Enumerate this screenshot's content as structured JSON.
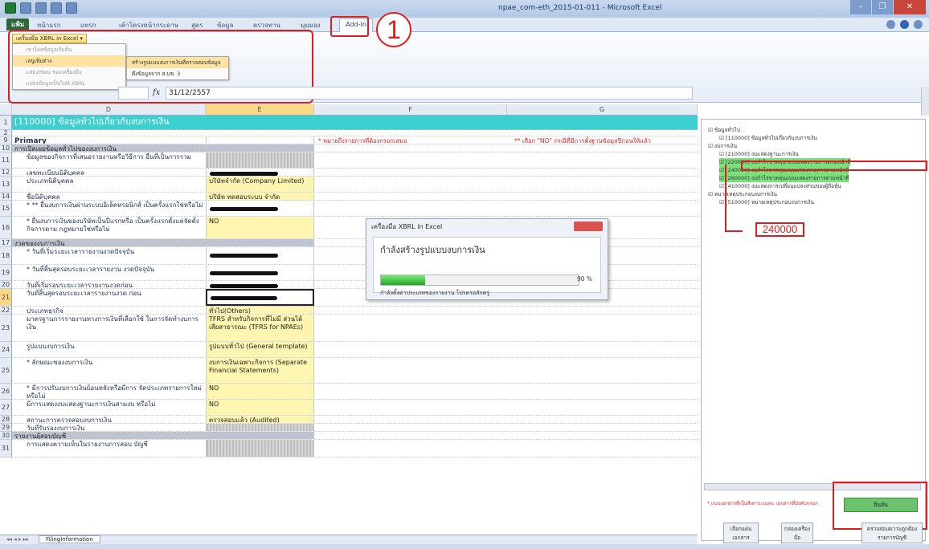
{
  "window": {
    "title": "npae_com-eth_2015-01-011 - Microsoft Excel"
  },
  "ribbon": {
    "file_tab": "แฟ้ม",
    "tabs": [
      "หน้าแรก",
      "แทรก",
      "เค้าโครงหน้ากระดาษ",
      "สูตร",
      "ข้อมูล",
      "ตรวจทาน",
      "มุมมอง"
    ],
    "addin_tab": "Add-In",
    "xbrl_button": "เครื่องมือ XBRL in Excel ▾",
    "menu_items": [
      "เขาโลหข้อมูลเริ่มต้น",
      "เลนูเพิ่มต่าง",
      "เเสดง/ซ่อน ชองเครื่องมือ",
      "เเปลงข้อมูลเป็นไฟล์ XBRL"
    ],
    "submenu_items": [
      "สร้างรูปแบบงบการเงินที่ตรวจสอบข้อมูล",
      "ดึงข้อมูลจาก ส.บช. 3"
    ]
  },
  "annotation": {
    "circle_label": "1",
    "label_240": "240000"
  },
  "formula_bar": {
    "fx_label": "fx",
    "value": "31/12/2557"
  },
  "grid": {
    "columns": [
      "D",
      "E",
      "F",
      "G"
    ],
    "note_required": "* หมายถึงรายการที่ต้องกรอกเสมอ",
    "note_no": "** เลือก \"NO\" กรณีที่มีการตั้งฐานข้อมูลปีกอนให้แล้ว",
    "rows": [
      {
        "num": "1",
        "d": "[110000] ข้อมูลทั่วไปเกี่ยวกับงบการเงิน",
        "e": ""
      },
      {
        "num": "2",
        "d": "",
        "e": ""
      },
      {
        "num": "9",
        "d": "Primary",
        "e": ""
      },
      {
        "num": "10",
        "d": "การเปิดเผยข้อมูลทั่วไปของงบการเงิน",
        "e": ""
      },
      {
        "num": "11",
        "d": "ข้อมูลของกิจการที่เสนอรายงานหรือวิธีการ อื่นที่เป็นการรวม",
        "e": ""
      },
      {
        "num": "12",
        "d": "เลขทะเบียนนิติบุคคล",
        "e": ""
      },
      {
        "num": "13",
        "d": "ประเภทนิติบุคคล",
        "e": "บริษัทจำกัด (Company Limited)"
      },
      {
        "num": "14",
        "d": "ชื่อนิติบุคคล",
        "e": "บริษัท ทดสอบระบบ จำกัด"
      },
      {
        "num": "15",
        "d": "* ** ยื่นงบการเงินผ่านระบบอิเล็คทรอนิกส์ เป็นครั้งแรกใช่หรือไม่",
        "e": ""
      },
      {
        "num": "16",
        "d": "* ยื่นงบการเงินของบริษัทเป็นปีแรกหรือ เป็นครั้งแรกตั้งแต่จัดตั้งกิจการตาม กฎหมายใช่หรือไม่",
        "e": "NO"
      },
      {
        "num": "17",
        "d": "งวดของงบการเงิน",
        "e": ""
      },
      {
        "num": "18",
        "d": "* วันที่เริ่มระยะเวลารายงานงวดปัจจุบัน",
        "e": ""
      },
      {
        "num": "19",
        "d": "* วันที่สิ้นสุดรอบระยะเวลารายงาน งวดปัจจุบัน",
        "e": ""
      },
      {
        "num": "20",
        "d": "วันที่เริ่มรอบระยะเวลารายงานงวดก่อน",
        "e": ""
      },
      {
        "num": "21",
        "d": "วันที่สิ้นสุดรอบระยะเวลารายงานงวด ก่อน",
        "e": ""
      },
      {
        "num": "22",
        "d": "ประเภทธุรกิจ",
        "e": "ทั่วไป(Others)"
      },
      {
        "num": "23",
        "d": "มาตรฐานการรายงานทางการเงินที่เลือกใช้ ในการจัดทำงบการเงิน",
        "e": "TFRS สำหรับกิจการที่ไม่มี ส่วนได้เสียสาธารณะ (TFRS for NPAEs)"
      },
      {
        "num": "24",
        "d": "รูปแบบงบการเงิน",
        "e": "รูปแบบทั่วไป (General template)"
      },
      {
        "num": "25",
        "d": "* ลักษณะของงบการเงิน",
        "e": "งบการเงินเฉพาะกิจการ (Separate Financial Statements)"
      },
      {
        "num": "26",
        "d": "* มีการปรับงบการเงินย้อนหลังหรือมีการ จัดประเภทรายการใหม่หรือไม่",
        "e": "NO"
      },
      {
        "num": "27",
        "d": "มีการแสดงงบแสดงฐานะการเงินสามงบ หรือไม่",
        "e": "NO"
      },
      {
        "num": "28",
        "d": "สถานะการตรวจสอบงบการเงิน",
        "e": "ตรวจสอบแล้ว (Audited)"
      },
      {
        "num": "29",
        "d": "วันที่รับรองงบการเงิน",
        "e": ""
      },
      {
        "num": "30",
        "d": "รายงานผู้สอบบัญชี",
        "e": ""
      },
      {
        "num": "31",
        "d": "การแสดงความเห็นในรายงานการสอบ บัญชี",
        "e": ""
      }
    ]
  },
  "dialog": {
    "title": "เครื่องมือ XBRL in Excel",
    "heading": "กำลังสร้างรูปแบบงบการเงิน",
    "progress_percent": 90,
    "percent_label": "90 %",
    "status": "กำลังตั้งค่าประเภทของรายงาน โปรดรอสักครู่"
  },
  "pane": {
    "tree": [
      "ข้อมูลทั่วไป",
      "[110000] ข้อมูลทั่วไปเกี่ยวกับงบการเงิน",
      "งบการเงิน",
      "[210000] งบแสดงฐานะการเงิน",
      "[220000] งบกำไรขาดทุน แบบแสดงรายการตามหน้าที่",
      "[240000] งบกำไรขาดทุนแบบแสดงรายการตามหน้าที่",
      "[260000] งบกำไรขาดทุนแบบแสดงรายการตามหน้าที่",
      "[410000] งบแสดงการเปลี่ยนแปลงส่วนของผู้ถือหุ้น",
      "หมายเหตุประกอบงบการเงิน",
      "[510000] หมายเหตุประกอบงบการเงิน"
    ],
    "note": "* แบบเอกสารที่เป็นสีเทาระบบจะ เอกสารที่บังคับกรอก",
    "ok_button": "ยืนยัน",
    "buttons": [
      "เลือกแผ่น เอกสาร",
      "กล่องเครื่อง มือ",
      "ตรวจสอบความถูกต้อง รายการบัญชี"
    ]
  },
  "sheet": {
    "tab_name": "FilingInformation"
  },
  "colors": {
    "teal_header": "#3ccfcf",
    "yellow_cell": "#fdf5b0",
    "annotation_red": "#e01d1d",
    "progress_green": "#21a824"
  }
}
